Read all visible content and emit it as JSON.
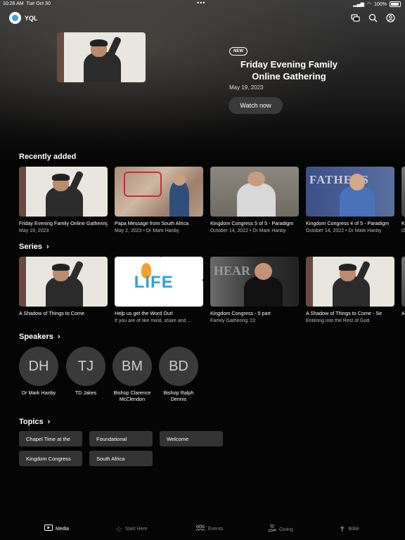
{
  "status_bar": {
    "time": "10:26 AM",
    "date": "Tue Oct 30",
    "battery": "100%"
  },
  "app": {
    "name": "YQL"
  },
  "nav_icons": [
    "chat-icon",
    "search-icon",
    "account-icon"
  ],
  "hero": {
    "badge": "NEW",
    "title": "Friday Evening Family Online Gathering",
    "date": "May 19, 2023",
    "button": "Watch now"
  },
  "recently_added": {
    "title": "Recently added",
    "items": [
      {
        "title": "Friday Evening Family Online Gathering",
        "sub": "May 19, 2023"
      },
      {
        "title": "Papa Message from South Africa",
        "sub": "May 2, 2023 • Dr Mark Hanby"
      },
      {
        "title": "Kingdom Congress 5 of 5 - Paradigm",
        "sub": "October 14, 2022 • Dr Mark Hanby"
      },
      {
        "title": "Kingdom Congress 4 of 5 - Paradigm",
        "sub": "October 14, 2022 • Dr Mark Hanby"
      },
      {
        "title": "K",
        "sub": "O"
      }
    ]
  },
  "series": {
    "title": "Series",
    "items": [
      {
        "title": "A Shadow of Things to Come",
        "sub": ""
      },
      {
        "title": "Help us get the Word Out!",
        "sub": "If you are of like mind, share and ..."
      },
      {
        "title": "Kingdom Congress - 5 part",
        "sub": "Family Gathering '22"
      },
      {
        "title": "A Shadow of Things to Come - Se",
        "sub": "Entering into the Rest of God"
      },
      {
        "title": "A",
        "sub": ""
      }
    ]
  },
  "speakers": {
    "title": "Speakers",
    "items": [
      {
        "initials": "DH",
        "name": "Dr Mark Hanby"
      },
      {
        "initials": "TJ",
        "name": "TD Jakes"
      },
      {
        "initials": "BM",
        "name": "Bishop Clarence McClendon"
      },
      {
        "initials": "BD",
        "name": "Bishop Ralph Dennis"
      }
    ]
  },
  "topics": {
    "title": "Topics",
    "items": [
      "Chapel Time at the",
      "Foundational",
      "Welcome",
      "Kingdom Congress",
      "South Africa"
    ]
  },
  "tabs": [
    {
      "label": "Media",
      "icon": "media-icon",
      "active": true
    },
    {
      "label": "Start Here",
      "icon": "star-icon",
      "active": false
    },
    {
      "label": "Events",
      "icon": "people-icon",
      "active": false
    },
    {
      "label": "Giving",
      "icon": "giving-icon",
      "active": false
    },
    {
      "label": "Bible",
      "icon": "cross-icon",
      "active": false
    }
  ],
  "thumb_word": {
    "fathers": "FATHERS",
    "life": "LIFE",
    "dark": "HEAR"
  }
}
